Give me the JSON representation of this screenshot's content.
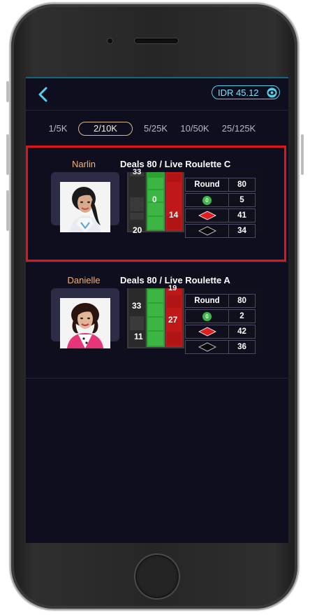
{
  "header": {
    "balance": "IDR 45.12"
  },
  "limits": [
    {
      "label": "1/5K",
      "active": false
    },
    {
      "label": "2/10K",
      "active": true
    },
    {
      "label": "5/25K",
      "active": false
    },
    {
      "label": "10/50K",
      "active": false
    },
    {
      "label": "25/125K",
      "active": false
    }
  ],
  "tables": [
    {
      "dealer": "Narlin",
      "title": "Deals 80 / Live Roulette C",
      "beads": {
        "left_top": "33",
        "left_bottom": "20",
        "green": "0",
        "red": "14"
      },
      "stats": {
        "round_label": "Round",
        "round": "80",
        "zero_label": "0",
        "zero": "5",
        "red": "41",
        "black": "34"
      },
      "highlighted": true
    },
    {
      "dealer": "Danielle",
      "title": "Deals 80 / Live Roulette A",
      "beads": {
        "left_top": "33",
        "left_bottom": "11",
        "green": "",
        "red_top": "19",
        "red": "27"
      },
      "stats": {
        "round_label": "Round",
        "round": "80",
        "zero_label": "0",
        "zero": "2",
        "red": "42",
        "black": "36"
      },
      "highlighted": false
    }
  ],
  "colors": {
    "accent": "#58cfe8",
    "highlight": "#e0141b",
    "dealer_name": "#f0b27a",
    "red": "#d11f1f",
    "green": "#2fa134"
  }
}
